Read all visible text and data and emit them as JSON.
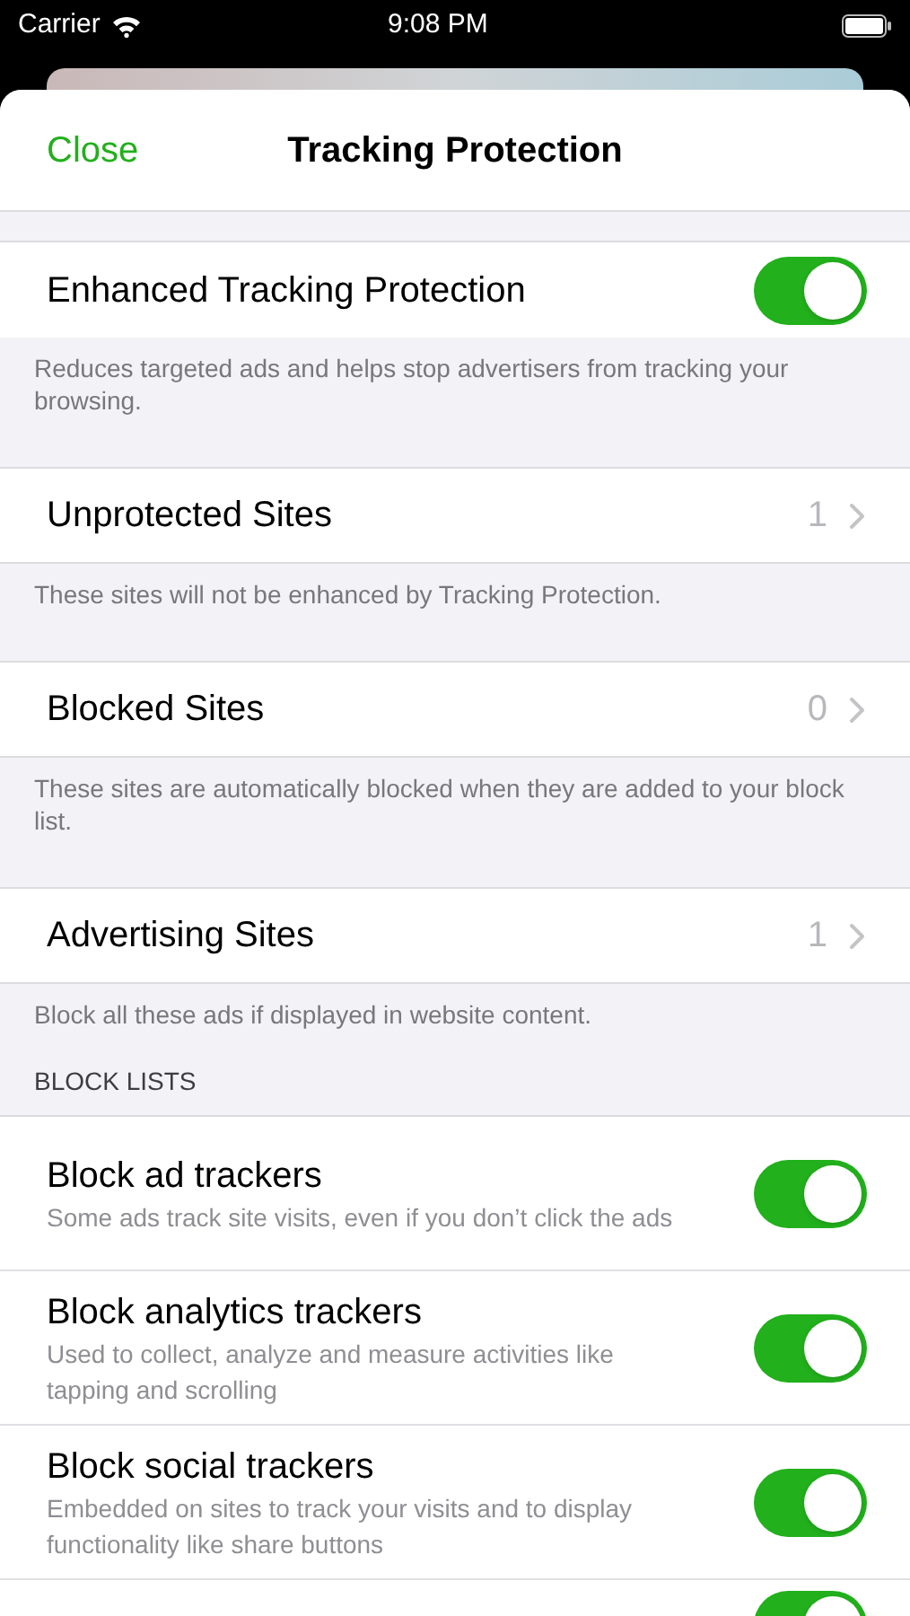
{
  "status_bar": {
    "carrier": "Carrier",
    "time": "9:08 PM"
  },
  "nav": {
    "close": "Close",
    "title": "Tracking Protection"
  },
  "sections": [
    {
      "rows": [
        {
          "kind": "toggle",
          "title": "Enhanced Tracking Protection",
          "on": true
        }
      ],
      "footer": "Reduces targeted ads and helps stop advertisers from tracking your browsing."
    },
    {
      "rows": [
        {
          "kind": "link",
          "title": "Unprotected Sites",
          "value": "1"
        }
      ],
      "footer": "These sites will not be enhanced by Tracking Protection."
    },
    {
      "rows": [
        {
          "kind": "link",
          "title": "Blocked Sites",
          "value": "0"
        }
      ],
      "footer": "These sites are automatically blocked when they are added to your block list."
    },
    {
      "rows": [
        {
          "kind": "link",
          "title": "Advertising Sites",
          "value": "1"
        }
      ],
      "footer": "Block all these ads if displayed in website content."
    },
    {
      "header": "BLOCK LISTS",
      "rows": [
        {
          "kind": "toggle",
          "title": "Block ad trackers",
          "subtitle": "Some ads track site visits, even if you don’t click the ads",
          "on": true
        },
        {
          "kind": "toggle",
          "title": "Block analytics trackers",
          "subtitle": "Used to collect, analyze and measure activities like tapping and scrolling",
          "on": true
        },
        {
          "kind": "toggle",
          "title": "Block social trackers",
          "subtitle": "Embedded on sites to track your visits and to display functionality like share buttons",
          "on": true
        },
        {
          "kind": "toggle",
          "on": true
        }
      ]
    }
  ]
}
